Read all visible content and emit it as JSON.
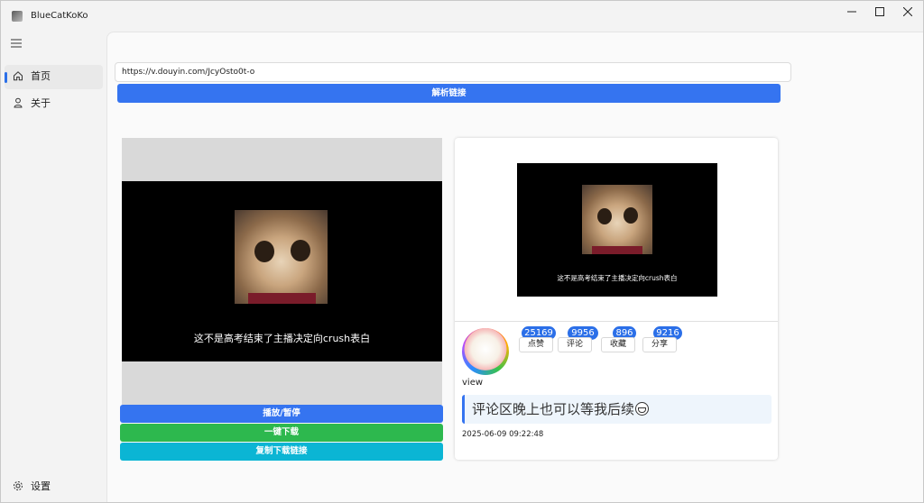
{
  "window": {
    "title": "BlueCatKoKo"
  },
  "nav": {
    "items": [
      {
        "label": "首页",
        "icon": "home-icon",
        "active": true
      },
      {
        "label": "关于",
        "icon": "user-icon",
        "active": false
      }
    ],
    "settings": {
      "label": "设置",
      "icon": "gear-icon"
    }
  },
  "form": {
    "url_value": "https://v.douyin.com/JcyOsto0t-o",
    "parse_button": "解析链接"
  },
  "player": {
    "caption": "这不是高考结束了主播决定向crush表白",
    "play_button": "播放/暂停",
    "download_button": "一键下载",
    "copy_button": "复制下载链接"
  },
  "card": {
    "thumb_caption": "这不是高考结束了主播决定向crush表白",
    "author": "view",
    "stats": [
      {
        "count": "25169",
        "label": "点赞"
      },
      {
        "count": "9956",
        "label": "评论"
      },
      {
        "count": "896",
        "label": "收藏"
      },
      {
        "count": "9216",
        "label": "分享"
      }
    ],
    "description": "评论区晚上也可以等我后续",
    "timestamp": "2025-06-09 09:22:48"
  },
  "colors": {
    "primary": "#3574f0",
    "success": "#2db84e",
    "info": "#0bb5d4",
    "badge": "#2b6fe8"
  }
}
